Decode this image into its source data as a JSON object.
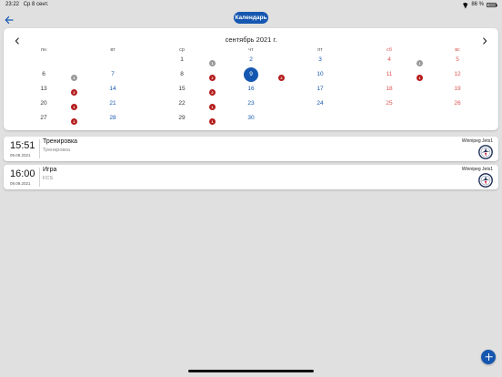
{
  "status_bar": {
    "time": "23:22",
    "date": "Ср 8 сент.",
    "battery": "86 %",
    "battery_level": 0.86
  },
  "nav": {
    "title": "Календарь"
  },
  "calendar": {
    "month_title": "сентябрь 2021 г.",
    "weekdays": [
      "пн",
      "вт",
      "ср",
      "чт",
      "пт",
      "сб",
      "вс"
    ],
    "rows": [
      [
        "",
        "",
        "1",
        "2",
        "3",
        "4",
        "5"
      ],
      [
        "6",
        "7",
        "8",
        "9",
        "10",
        "11",
        "12"
      ],
      [
        "13",
        "14",
        "15",
        "16",
        "17",
        "18",
        "19"
      ],
      [
        "20",
        "21",
        "22",
        "23",
        "24",
        "25",
        "26"
      ],
      [
        "27",
        "28",
        "29",
        "30",
        "",
        "",
        ""
      ]
    ],
    "today": "9",
    "badges": [
      {
        "row": 0,
        "col": 2,
        "color": "gray",
        "label": "1"
      },
      {
        "row": 0,
        "col": 5,
        "color": "gray",
        "label": "1"
      },
      {
        "row": 1,
        "col": 0,
        "color": "gray",
        "label": "1"
      },
      {
        "row": 1,
        "col": 2,
        "color": "red",
        "label": "2"
      },
      {
        "row": 1,
        "col": 3,
        "color": "red",
        "label": "2"
      },
      {
        "row": 1,
        "col": 5,
        "color": "red",
        "label": "1"
      },
      {
        "row": 2,
        "col": 0,
        "color": "red",
        "label": "2"
      },
      {
        "row": 2,
        "col": 2,
        "color": "red",
        "label": "2"
      },
      {
        "row": 3,
        "col": 0,
        "color": "red",
        "label": "1"
      },
      {
        "row": 3,
        "col": 2,
        "color": "red",
        "label": "1"
      },
      {
        "row": 4,
        "col": 0,
        "color": "red",
        "label": "2"
      },
      {
        "row": 4,
        "col": 2,
        "color": "red",
        "label": "1"
      }
    ]
  },
  "events": [
    {
      "time": "15:51",
      "date": "09.09.2021",
      "title": "Тренировка",
      "subtitle": "Тренировка",
      "team": "Winnipeg Jets1"
    },
    {
      "time": "16:00",
      "date": "09.09.2021",
      "title": "Игра",
      "subtitle": "FCS",
      "team": "Winnipeg Jets1"
    }
  ],
  "colors": {
    "accent": "#1557b0",
    "weekend": "#d9534f",
    "badge_red": "#b41c1c",
    "badge_gray": "#9a9a9a"
  },
  "icons": {
    "back": "arrow-left-icon",
    "prev": "chevron-left-icon",
    "next": "chevron-right-icon",
    "fab": "plus-icon",
    "team_logo": "jets-logo-icon"
  }
}
